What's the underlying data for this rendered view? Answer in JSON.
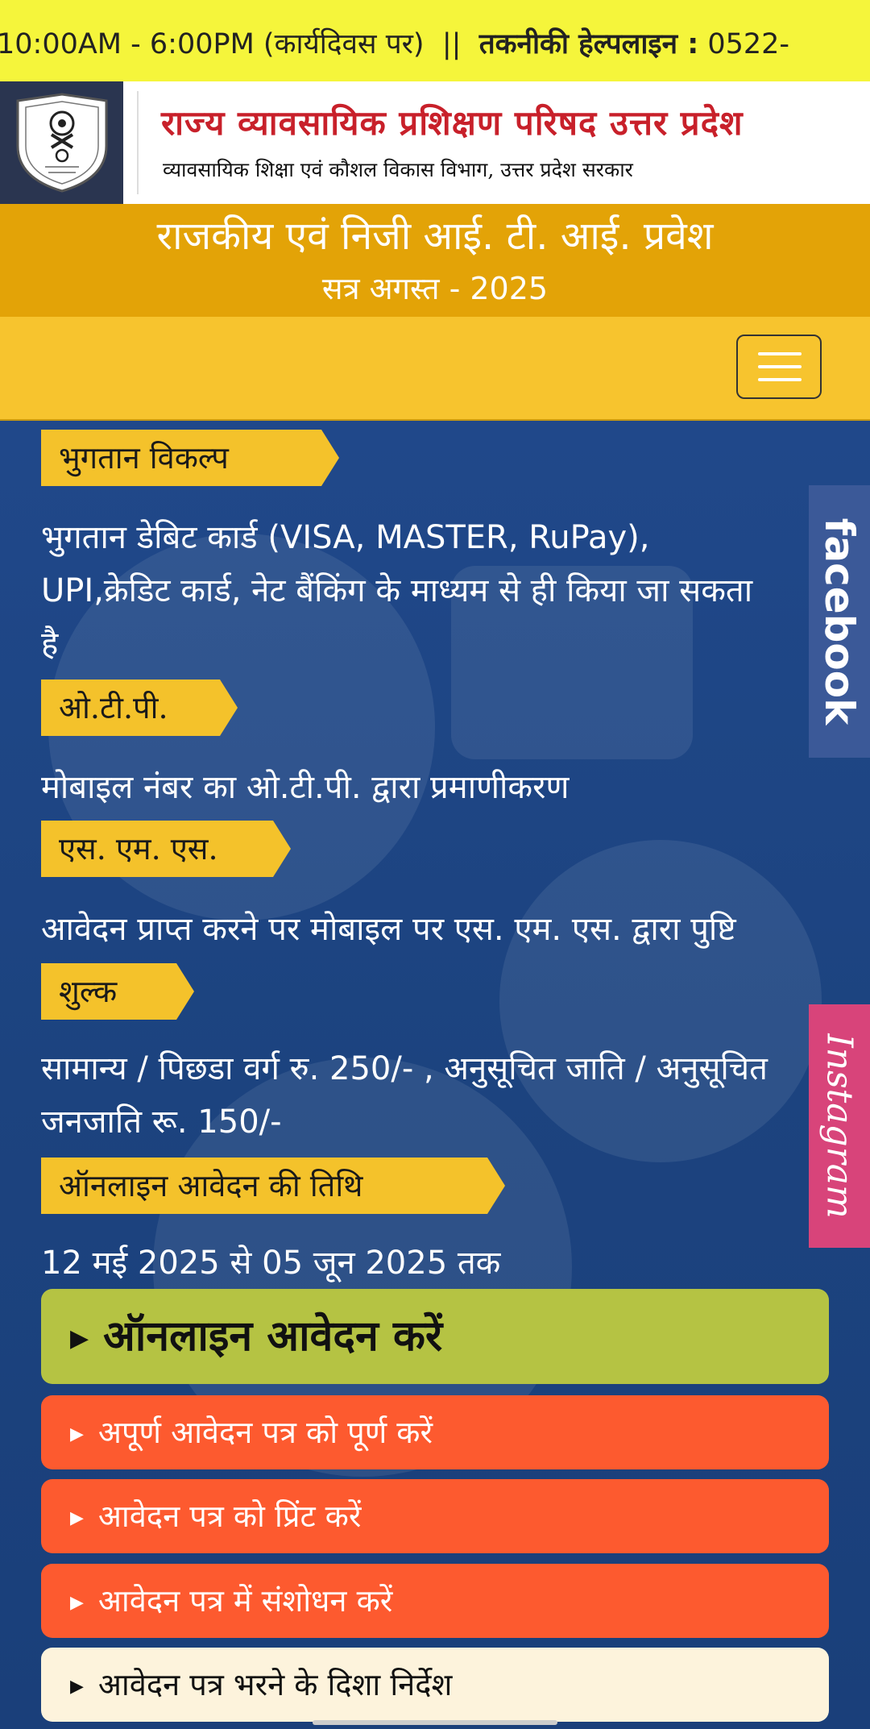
{
  "ticker": {
    "timing": "10:00AM - 6:00PM (कार्यदिवस पर)",
    "separator": "||",
    "helpline_label": "तकनीकी हेल्पलाइन :",
    "helpline_number": "0522-"
  },
  "header": {
    "org_name": "राज्य व्यावसायिक प्रशिक्षण परिषद उत्तर प्रदेश",
    "org_sub": "व्यावसायिक शिक्षा एवं कौशल विकास विभाग, उत्तर प्रदेश सरकार"
  },
  "banner": {
    "title": "राजकीय एवं निजी आई. टी. आई. प्रवेश",
    "subtitle": "सत्र अगस्त - 2025"
  },
  "sections": [
    {
      "tag": "भुगतान विकल्प",
      "text": "भुगतान डेबिट कार्ड (VISA, MASTER, RuPay), UPI,क्रेडिट कार्ड, नेट बैंकिंग के माध्यम से ही किया जा सकता है"
    },
    {
      "tag": "ओ.टी.पी.",
      "text": "मोबाइल नंबर का ओ.टी.पी. द्वारा प्रमाणीकरण"
    },
    {
      "tag": "एस. एम. एस.",
      "text": "आवेदन प्राप्त करने पर मोबाइल पर एस. एम. एस. द्वारा पुष्टि"
    },
    {
      "tag": "शुल्क",
      "text": "सामान्य / पिछडा वर्ग रु. 250/- , अनुसूचित जाति / अनुसूचित जनजाति रू. 150/-"
    },
    {
      "tag": "ऑनलाइन आवेदन की तिथि",
      "text": "12 मई 2025 से 05 जून 2025 तक"
    }
  ],
  "social": {
    "facebook": "facebook",
    "instagram": "Instagram"
  },
  "buttons": {
    "apply": "ऑनलाइन आवेदन करें",
    "complete": "अपूर्ण आवेदन पत्र को पूर्ण करें",
    "print": "आवेदन पत्र को प्रिंट करें",
    "edit": "आवेदन पत्र में संशोधन करें",
    "guidelines": "आवेदन पत्र भरने के दिशा निर्देश"
  },
  "colors": {
    "ticker_bg": "#f5f53b",
    "banner_bg": "#e3a307",
    "navbar_bg": "#f7c42e",
    "content_bg": "#1f4583",
    "tag_bg": "#f4c22b",
    "apply_btn": "#b5c343",
    "orange_btn": "#fd5a2f",
    "guide_btn": "#fdf3dc",
    "facebook": "#3b5998",
    "instagram": "#d8447a"
  }
}
